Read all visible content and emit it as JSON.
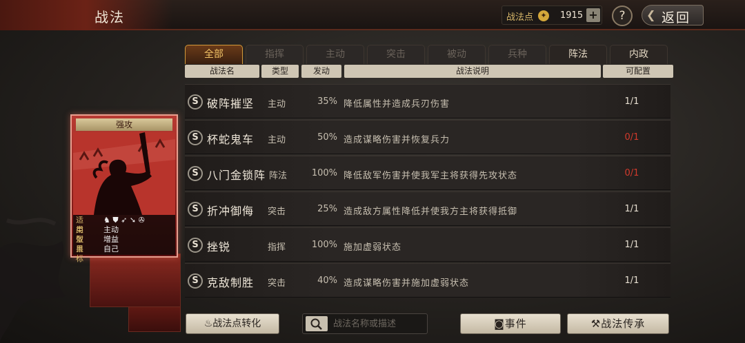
{
  "header": {
    "title": "战法",
    "points_label": "战法点",
    "points_value": "1915",
    "plus": "+",
    "help": "?",
    "back_label": "返回"
  },
  "tabs": [
    {
      "label": "全部",
      "state": "active"
    },
    {
      "label": "指挥",
      "state": "dim"
    },
    {
      "label": "主动",
      "state": "dim"
    },
    {
      "label": "突击",
      "state": "dim"
    },
    {
      "label": "被动",
      "state": "dim"
    },
    {
      "label": "兵种",
      "state": "dim"
    },
    {
      "label": "阵法",
      "state": "bright"
    },
    {
      "label": "内政",
      "state": "bright"
    }
  ],
  "columns": {
    "name": "战法名",
    "type": "类型",
    "rate": "发动",
    "desc": "战法说明",
    "cfg": "可配置"
  },
  "rows": [
    {
      "badge": "S",
      "name": "破阵摧坚",
      "type": "主动",
      "rate": "35%",
      "desc": "降低属性并造成兵刃伤害",
      "cfg": "1/1",
      "cfg_color": "normal"
    },
    {
      "badge": "S",
      "name": "杯蛇鬼车",
      "type": "主动",
      "rate": "50%",
      "desc": "造成谋略伤害并恢复兵力",
      "cfg": "0/1",
      "cfg_color": "red"
    },
    {
      "badge": "S",
      "name": "八门金锁阵",
      "type": "阵法",
      "rate": "100%",
      "desc": "降低敌军伤害并使我军主将获得先攻状态",
      "cfg": "0/1",
      "cfg_color": "red"
    },
    {
      "badge": "S",
      "name": "折冲御侮",
      "type": "突击",
      "rate": "25%",
      "desc": "造成敌方属性降低并使我方主将获得抵御",
      "cfg": "1/1",
      "cfg_color": "normal"
    },
    {
      "badge": "S",
      "name": "挫锐",
      "type": "指挥",
      "rate": "100%",
      "desc": "施加虚弱状态",
      "cfg": "1/1",
      "cfg_color": "normal"
    },
    {
      "badge": "S",
      "name": "克敌制胜",
      "type": "突击",
      "rate": "40%",
      "desc": "造成谋略伤害并施加虚弱状态",
      "cfg": "1/1",
      "cfg_color": "normal"
    }
  ],
  "card": {
    "title": "强攻",
    "info": [
      {
        "key": "适用",
        "value": ""
      },
      {
        "key": "类型",
        "value": "主动"
      },
      {
        "key": "效果",
        "value": "增益"
      },
      {
        "key": "目标",
        "value": "自己"
      }
    ],
    "applicable_icons": [
      "cavalry-icon",
      "shield-icon",
      "bow-icon",
      "spear-icon",
      "wheel-icon"
    ]
  },
  "bottom": {
    "convert_label": "战法点转化",
    "search_placeholder": "战法名称或描述",
    "event_label": "事件",
    "inherit_label": "战法传承"
  },
  "colors": {
    "accent_gold": "#f1c266",
    "red_value": "#d33a2c",
    "card_red": "#b83a32"
  }
}
